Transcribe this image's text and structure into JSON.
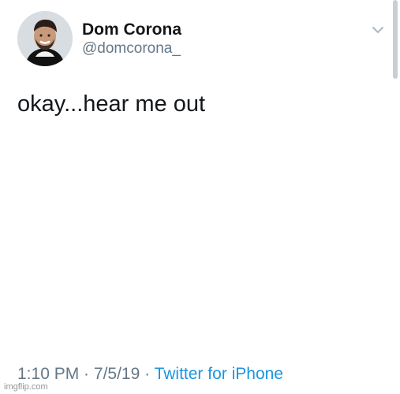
{
  "tweet": {
    "author": {
      "display_name": "Dom Corona",
      "handle": "@domcorona_"
    },
    "text": "okay...hear me out",
    "time": "1:10 PM",
    "separator_1": " · ",
    "date": "7/5/19",
    "separator_2": " · ",
    "source": "Twitter for iPhone"
  },
  "watermark": "imgflip.com",
  "icons": {
    "chevron": "chevron-down-icon",
    "avatar": "avatar"
  },
  "colors": {
    "primary_text": "#14171a",
    "secondary_text": "#657786",
    "link": "#1b95e0",
    "background": "#ffffff"
  }
}
